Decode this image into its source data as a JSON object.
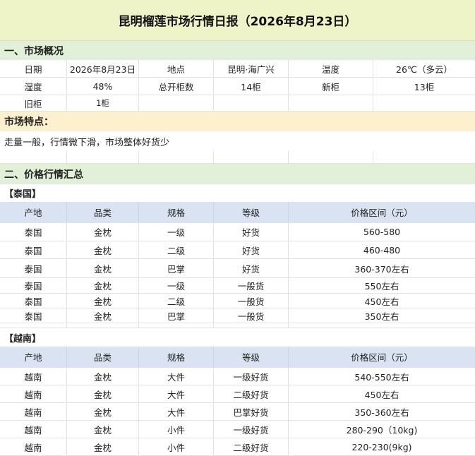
{
  "title": "昆明榴莲市场行情日报（2026年8月23日）",
  "overview": {
    "section_title": "一、市场概况",
    "row1": [
      "日期",
      "2026年8月23日",
      "地点",
      "昆明·海广兴",
      "温度",
      "26℃（多云）"
    ],
    "row2": [
      "湿度",
      "48%",
      "总开柜数",
      "14柜",
      "新柜",
      "13柜"
    ],
    "row3": [
      "旧柜",
      "1柜",
      "",
      "",
      "",
      ""
    ]
  },
  "features": {
    "title": "市场特点：",
    "text": "走量一般，行情微下滑，市场整体好货少"
  },
  "price": {
    "section_title": "二、价格行情汇总",
    "headers": [
      "产地",
      "品类",
      "规格",
      "等级",
      "价格区间（元）"
    ],
    "groups": [
      {
        "label": "【泰国】",
        "rows": [
          [
            "泰国",
            "金枕",
            "一级",
            "好货",
            "560-580"
          ],
          [
            "泰国",
            "金枕",
            "二级",
            "好货",
            "460-480"
          ],
          [
            "泰国",
            "金枕",
            "巴掌",
            "好货",
            "360-370左右"
          ],
          [
            "泰国",
            "金枕",
            "一级",
            "一般货",
            "550左右"
          ],
          [
            "泰国",
            "金枕",
            "二级",
            "一般货",
            "450左右"
          ],
          [
            "泰国",
            "金枕",
            "巴掌",
            "一般货",
            "350左右"
          ]
        ]
      },
      {
        "label": "【越南】",
        "rows": [
          [
            "越南",
            "金枕",
            "大件",
            "一级好货",
            "540-550左右"
          ],
          [
            "越南",
            "金枕",
            "大件",
            "二级好货",
            "450左右"
          ],
          [
            "越南",
            "金枕",
            "大件",
            "巴掌好货",
            "350-360左右"
          ],
          [
            "越南",
            "金枕",
            "小件",
            "一级好货",
            "280-290（10kg)"
          ],
          [
            "越南",
            "金枕",
            "小件",
            "二级好货",
            "220-230(9kg)"
          ]
        ]
      }
    ]
  }
}
